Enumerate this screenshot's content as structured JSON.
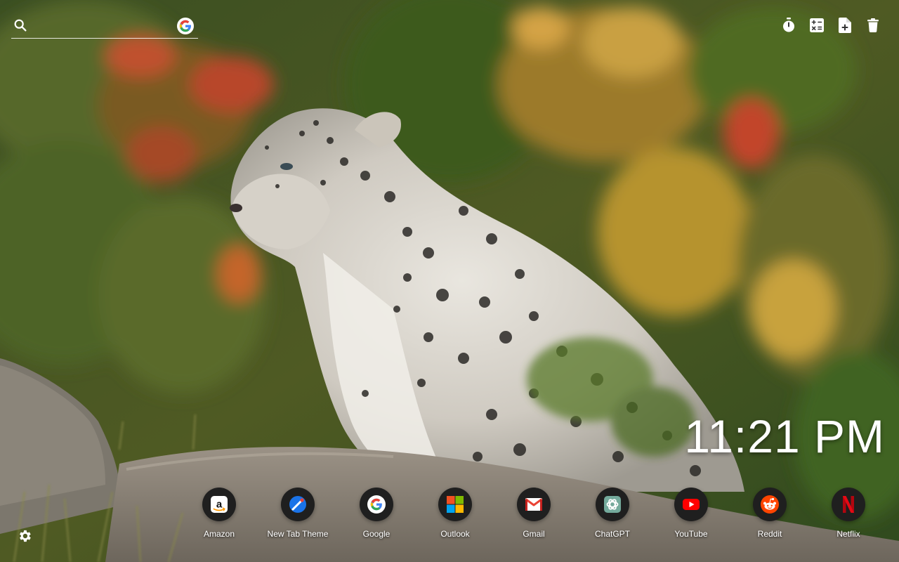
{
  "search": {
    "placeholder": "",
    "engine_icon": "google-g-icon"
  },
  "toolbar": {
    "items": [
      {
        "name": "timer-icon"
      },
      {
        "name": "calculator-icon"
      },
      {
        "name": "note-add-icon"
      },
      {
        "name": "trash-icon"
      }
    ]
  },
  "clock": {
    "time": "11:21 PM"
  },
  "shortcuts": [
    {
      "label": "Amazon",
      "icon": "amazon-icon"
    },
    {
      "label": "New Tab Theme",
      "icon": "new-tab-theme-icon"
    },
    {
      "label": "Google",
      "icon": "google-icon"
    },
    {
      "label": "Outlook",
      "icon": "outlook-icon"
    },
    {
      "label": "Gmail",
      "icon": "gmail-icon"
    },
    {
      "label": "ChatGPT",
      "icon": "chatgpt-icon"
    },
    {
      "label": "YouTube",
      "icon": "youtube-icon"
    },
    {
      "label": "Reddit",
      "icon": "reddit-icon"
    },
    {
      "label": "Netflix",
      "icon": "netflix-icon"
    }
  ],
  "settings": {
    "icon": "gear-icon"
  },
  "colors": {
    "text": "#ffffff",
    "icon_circle": "#1f1f1f"
  }
}
